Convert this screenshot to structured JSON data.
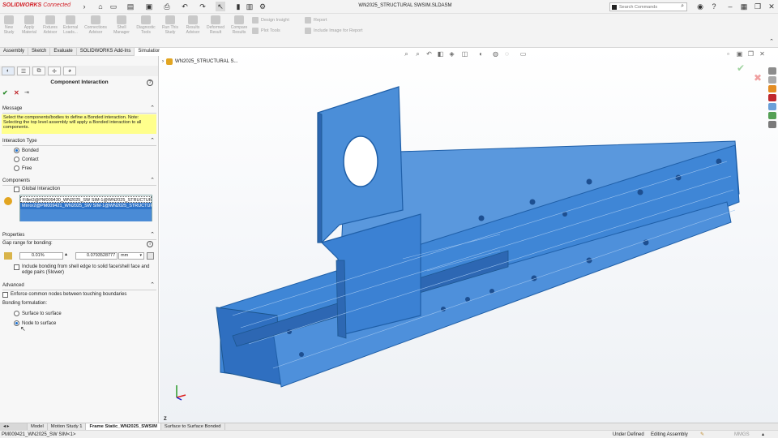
{
  "app": {
    "logo_brand": "SOLIDWORKS",
    "logo_suffix": "Connected",
    "document_title": "WN2025_STRUCTURAL SWSIM.SLDASM",
    "search_placeholder": "Search Commands"
  },
  "command_manager": {
    "commands": [
      {
        "label": "New Study"
      },
      {
        "label": "Apply Material"
      },
      {
        "label": "Fixtures Advisor"
      },
      {
        "label": "External Loads..."
      },
      {
        "label": "Connections Advisor"
      },
      {
        "label": "Shell Manager"
      },
      {
        "label": "Run This Study"
      },
      {
        "label": "Results Advisor"
      },
      {
        "label": "Deformed Result"
      },
      {
        "label": "Compare Results"
      }
    ],
    "extra": {
      "diagnostic": "Diagnostic Tools",
      "design_insight": "Design Insight",
      "plot_tools": "Plot Tools",
      "report": "Report",
      "include_image": "Include Image for Report"
    }
  },
  "tabs": [
    {
      "label": "Assembly",
      "active": false
    },
    {
      "label": "Sketch",
      "active": false
    },
    {
      "label": "Evaluate",
      "active": false
    },
    {
      "label": "SOLIDWORKS Add-Ins",
      "active": false
    },
    {
      "label": "Simulation",
      "active": true
    }
  ],
  "property_manager": {
    "title": "Component Interaction",
    "message_header": "Message",
    "message_text": "Select the components/bodies to define a Bonded interaction. Note: Selecting the top level assembly will apply a Bonded interaction to all components.",
    "interaction_header": "Interaction Type",
    "interaction_options": [
      "Bonded",
      "Contact",
      "Free"
    ],
    "interaction_selected": "Bonded",
    "components_header": "Components",
    "global_interaction_label": "Global Interaction",
    "components": [
      "Fillet3@PM009430_WN2025_SW SIM-1@WN2025_STRUCTURAL",
      "Mirror2@PM009421_WN2025_SW SIM-1@WN2025_STRUCTURAL"
    ],
    "properties_header": "Properties",
    "gap_label": "Gap range for bonding:",
    "gap_percent": "0.01%",
    "gap_value": "0.0793528777",
    "gap_unit": "mm",
    "shell_bonding_label": "Include bonding from shell edge to solid face/shell face and edge pairs (Slower)",
    "advanced_header": "Advanced",
    "enforce_label": "Enforce common nodes between touching boundaries",
    "bonding_formulation_label": "Bonding formulation:",
    "bonding_options": [
      "Surface to surface",
      "Node to surface"
    ],
    "bonding_selected": "Node to surface"
  },
  "viewport": {
    "tree_root": "WN2025_STRUCTURAL S...",
    "model_color": "#3f86d6",
    "triad_label": "Z"
  },
  "bottom_tabs": [
    {
      "label": "Model",
      "active": false
    },
    {
      "label": "Motion Study 1",
      "active": false
    },
    {
      "label": "Frame Static_WN2025_SWSIM",
      "active": true
    },
    {
      "label": "Surface to Surface Bonded",
      "active": false
    }
  ],
  "status_bar": {
    "left": "PM009421_WN2025_SW SIM<1>",
    "state": "Under Defined",
    "mode": "Editing Assembly",
    "units": "MMGS"
  }
}
